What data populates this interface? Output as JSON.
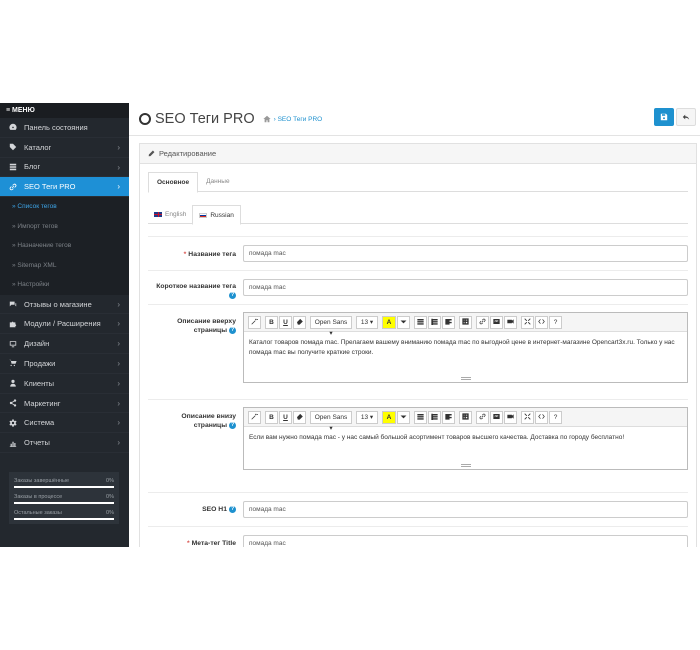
{
  "sidebar": {
    "menu_label": "≡ МЕНЮ",
    "items": [
      {
        "label": "Панель состояния",
        "icon": "dashboard-icon"
      },
      {
        "label": "Каталог",
        "icon": "tag-icon"
      },
      {
        "label": "Блог",
        "icon": "list-icon"
      },
      {
        "label": "SEO Теги PRO",
        "icon": "link-icon"
      }
    ],
    "subitems": [
      "» Список тегов",
      "» Импорт тегов",
      "» Назначение тегов",
      "» Sitemap XML",
      "» Настройки"
    ],
    "items_after": [
      {
        "label": "Отзывы о магазине",
        "icon": "comments-icon"
      },
      {
        "label": "Модули / Расширения",
        "icon": "puzzle-icon"
      },
      {
        "label": "Дизайн",
        "icon": "monitor-icon"
      },
      {
        "label": "Продажи",
        "icon": "cart-icon"
      },
      {
        "label": "Клиенты",
        "icon": "user-icon"
      },
      {
        "label": "Маркетинг",
        "icon": "share-icon"
      },
      {
        "label": "Система",
        "icon": "gear-icon"
      },
      {
        "label": "Отчеты",
        "icon": "chart-icon"
      }
    ],
    "stats": [
      {
        "label": "Заказы завершённые",
        "value": "0%"
      },
      {
        "label": "Заказы в процессе",
        "value": "0%"
      },
      {
        "label": "Остальные заказы",
        "value": "0%"
      }
    ],
    "chevron": "›"
  },
  "header": {
    "title": "SEO Теги PRO",
    "breadcrumb": "› SEO Теги PRO"
  },
  "panel": {
    "title": "Редактирование",
    "tabs": [
      "Основное",
      "Данные"
    ],
    "langs": [
      "English",
      "Russian"
    ]
  },
  "form": {
    "tag_name_label": "Название тега",
    "tag_name_value": "помада mac",
    "short_name_label": "Короткое название тега",
    "short_name_value": "помада mac",
    "desc_top_label": "Описание вверху страницы",
    "desc_top_text": "Каталог товаров помада mac. Прелагаем вашему вниманию помада mac по выгодной цене в интернет-магазине Opencart3x.ru. Только у нас помада mac вы получите краткие строки.",
    "desc_bottom_label": "Описание внизу страницы",
    "desc_bottom_text": "Если вам нужно помада mac - у нас самый большой асортимент товаров высшего качества. Доставка по городу бесплатно!",
    "seo_h1_label": "SEO H1",
    "seo_h1_value": "помада mac",
    "meta_title_label": "Мета-тег Title",
    "meta_title_value": "помада mac",
    "required_mark": "*",
    "help_mark": "?"
  },
  "toolbar": {
    "font": "Open Sans ▾",
    "size": "13 ▾",
    "bold": "B",
    "underline": "U",
    "color": "A",
    "help": "?"
  }
}
